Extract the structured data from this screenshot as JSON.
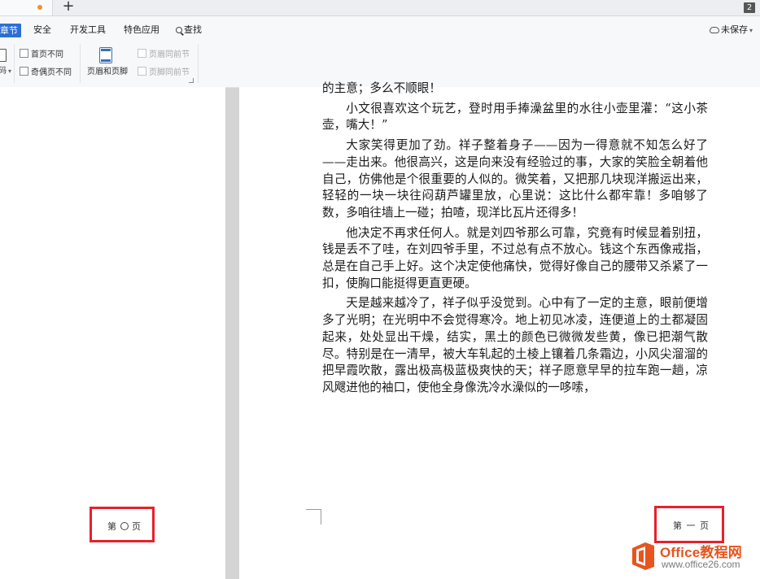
{
  "tabbar": {
    "new_tab_symbol": "+",
    "window_count": "2"
  },
  "menu": {
    "items": [
      "章节",
      "安全",
      "开发工具",
      "特色应用"
    ],
    "search_label": "查找",
    "save_status": "未保存"
  },
  "ribbon": {
    "page_number_fragment": "码",
    "first_page_diff": "首页不同",
    "odd_even_diff": "奇偶页不同",
    "header_footer": "页眉和页脚",
    "same_header_as_prev": "页眉同前节",
    "same_footer_as_prev": "页脚同前节"
  },
  "left_page": {
    "footer_prefix": "第",
    "footer_suffix": "页"
  },
  "right_page": {
    "paragraphs": [
      {
        "continued": true,
        "text": "的主意；多么不顺眼！"
      },
      {
        "continued": false,
        "text": "小文很喜欢这个玩艺，登时用手捧澡盆里的水往小壶里灌：“这小茶壶，嘴大！”"
      },
      {
        "continued": false,
        "text": "大家笑得更加了劲。祥子整着身子——因为一得意就不知怎么好了——走出来。他很高兴，这是向来没有经验过的事，大家的笑脸全朝着他自己，仿佛他是个很重要的人似的。微笑着，又把那几块现洋搬运出来，轻轻的一块一块往闷葫芦罐里放，心里说：这比什么都牢靠！多咱够了数，多咱往墙上一碰；拍喳，现洋比瓦片还得多！"
      },
      {
        "continued": false,
        "text": "他决定不再求任何人。就是刘四爷那么可靠，究竟有时候显着别扭，钱是丢不了哇，在刘四爷手里，不过总有点不放心。钱这个东西像戒指，总是在自己手上好。这个决定使他痛快，觉得好像自己的腰带又杀紧了一扣，使胸口能挺得更直更硬。"
      },
      {
        "continued": false,
        "text": "天是越来越冷了，祥子似乎没觉到。心中有了一定的主意，眼前便增多了光明；在光明中不会觉得寒冷。地上初见冰凌，连便道上的土都凝固起来，处处显出干燥，结实，黑土的颜色已微微发些黄，像已把潮气散尽。特别是在一清早，被大车轧起的土棱上镶着几条霜边，小风尖溜溜的把早霞吹散，露出极高极蓝极爽快的天；祥子愿意早早的拉车跑一趟，凉风飕进他的袖口，使他全身像洗冷水澡似的一哆嗦，"
      }
    ],
    "footer_text": "第 一 页"
  },
  "watermark": {
    "name": "Office教程网",
    "url": "www.office26.com"
  },
  "colors": {
    "accent": "#2b6fd6",
    "highlight_box": "#e8202a",
    "brand": "#e8541e",
    "modified_dot": "#f0932b"
  }
}
